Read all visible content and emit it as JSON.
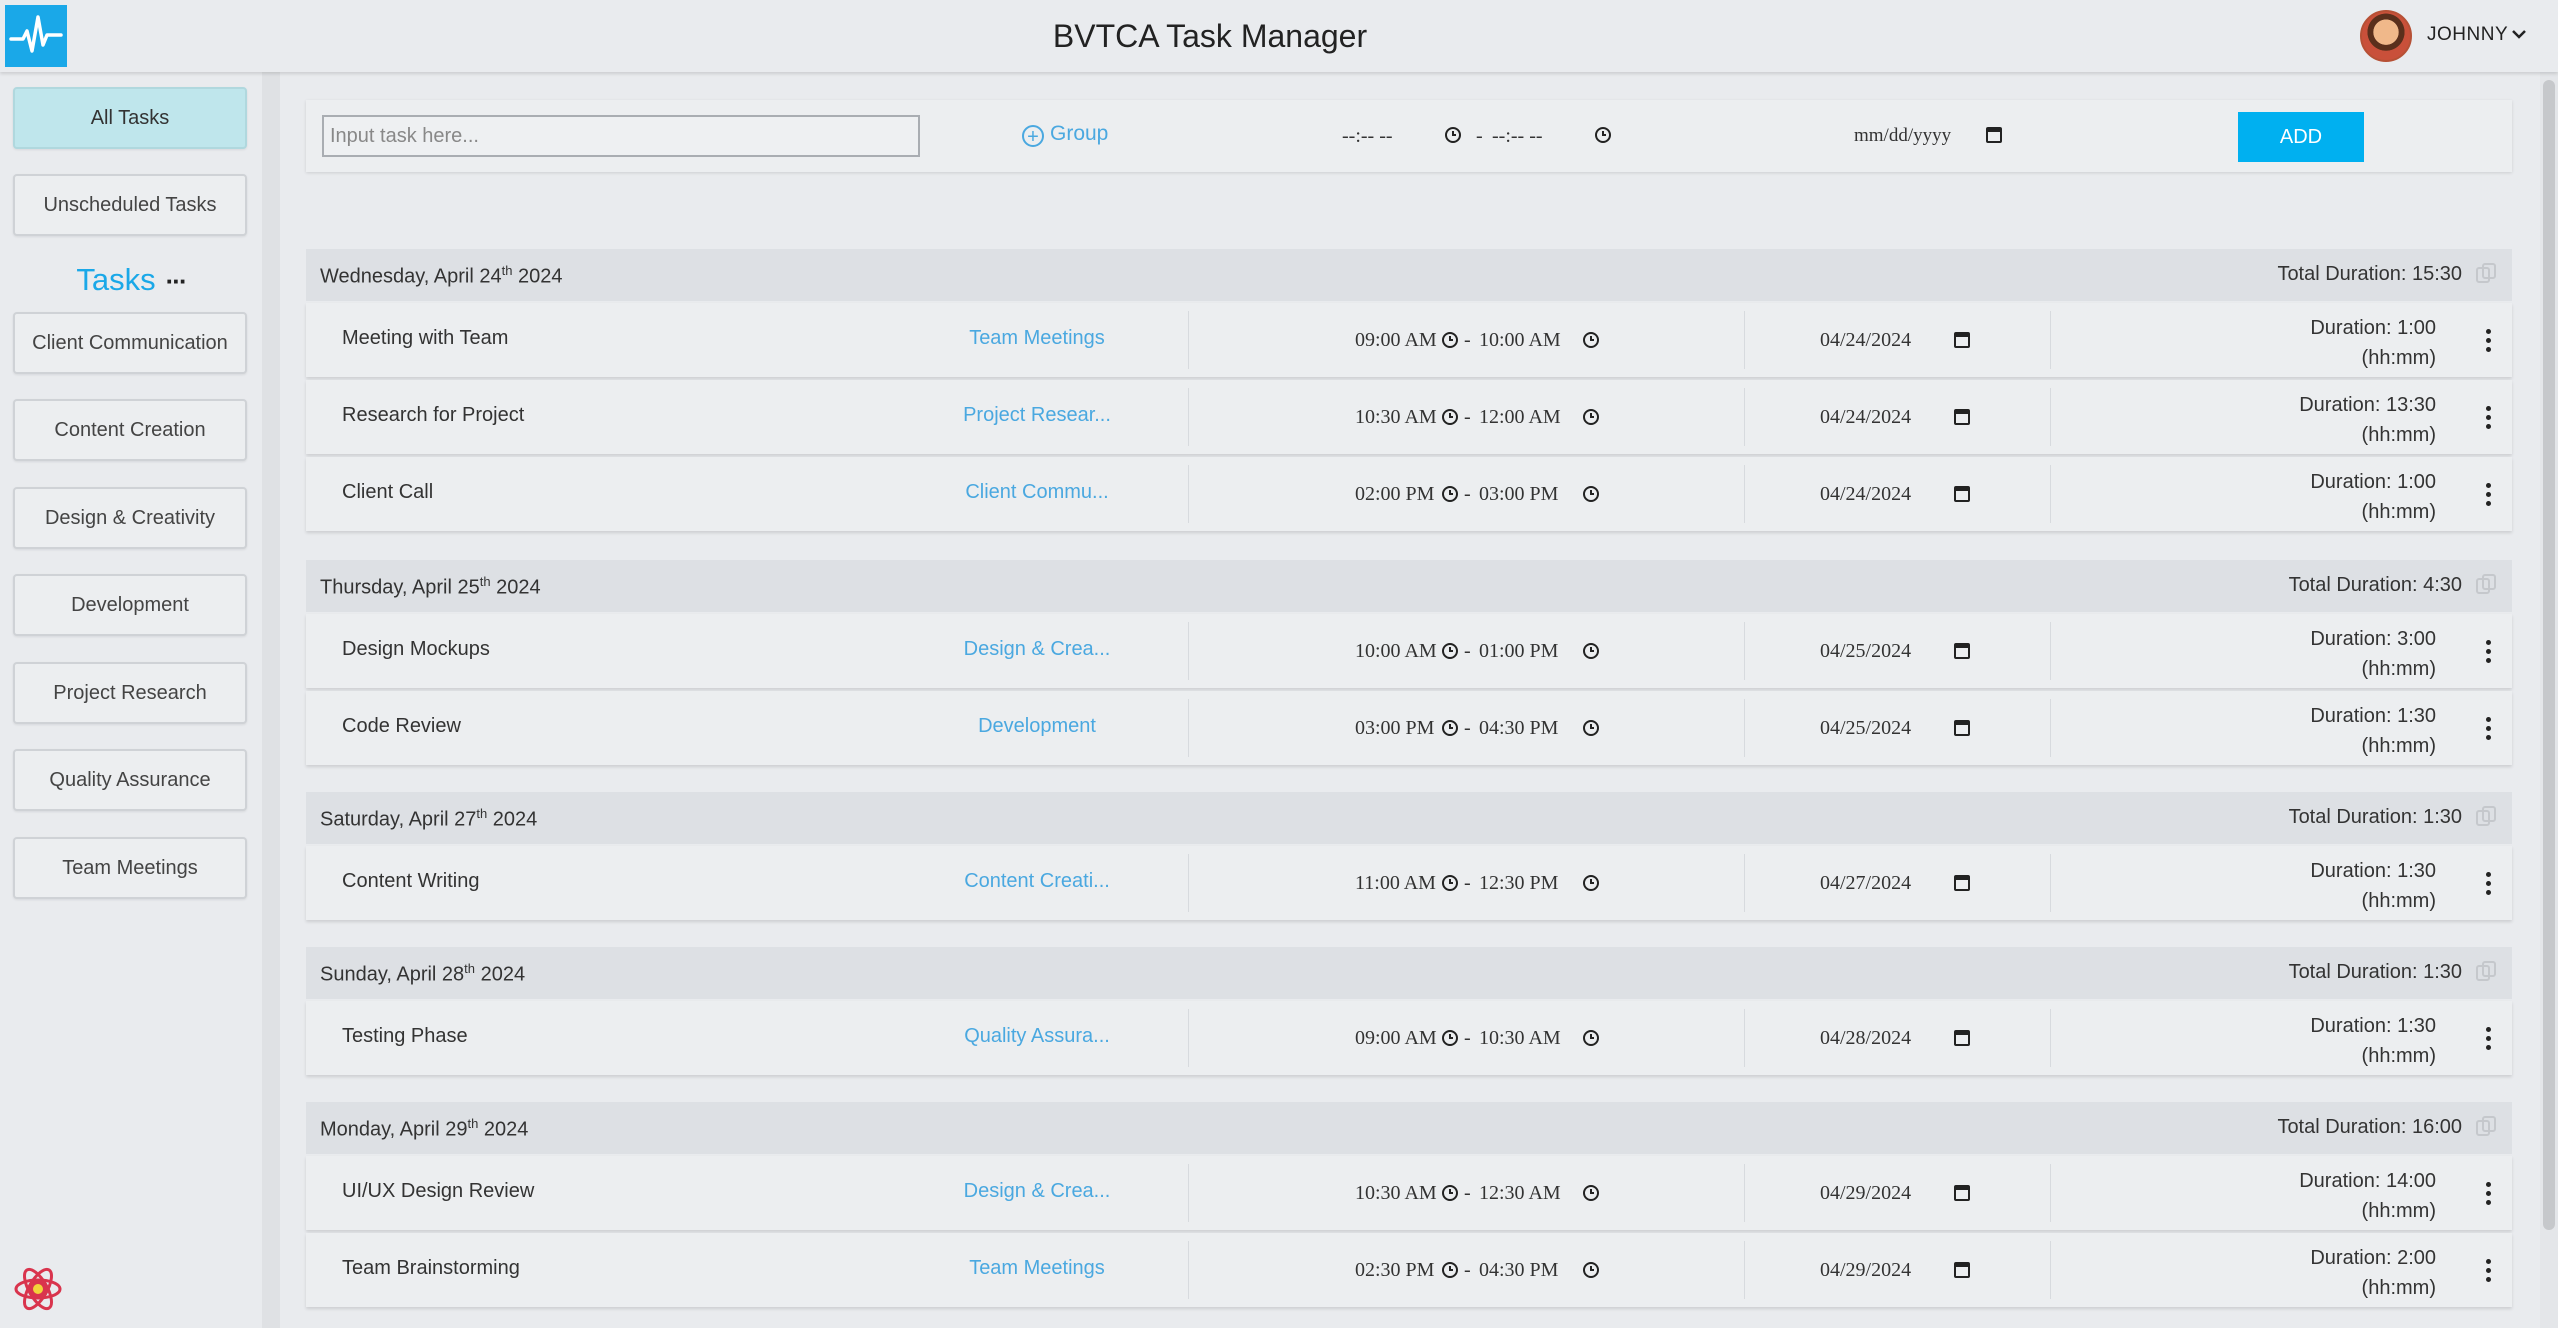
{
  "header": {
    "title": "BVTCA Task Manager",
    "username": "JOHNNY",
    "icons": {
      "logo": "heartbeat-icon",
      "menu": "chevron-down-icon"
    }
  },
  "sidebar": {
    "all_tasks": "All Tasks",
    "unscheduled": "Unscheduled Tasks",
    "tasks_heading": "Tasks",
    "tasks_more": "···",
    "groups": [
      "Client Communication",
      "Content Creation",
      "Design & Creativity",
      "Development",
      "Project Research",
      "Quality Assurance",
      "Team Meetings"
    ],
    "colors": {
      "accent": "#1aa8e8",
      "active_bg": "#bfe6ec"
    }
  },
  "input_bar": {
    "placeholder": "Input task here...",
    "group_label": "Group",
    "start_time": "--:-- --",
    "end_sep": "-",
    "end_time": "--:-- --",
    "date": "mm/dd/yyyy",
    "add_label": "ADD",
    "colors": {
      "add_button": "#00b0f0"
    }
  },
  "days": [
    {
      "date": "Wednesday, April 24",
      "suffix": "th",
      "year": " 2024",
      "total": "Total Duration: 15:30",
      "tasks": [
        {
          "name": "Meeting with Team",
          "group": "Team Meetings",
          "start": "09:00 AM",
          "end": "10:00 AM",
          "date": "04/24/2024",
          "dur": "Duration: 1:00",
          "unit": "(hh:mm)"
        },
        {
          "name": "Research for Project",
          "group": "Project Resear...",
          "start": "10:30 AM",
          "end": "12:00 AM",
          "date": "04/24/2024",
          "dur": "Duration: 13:30",
          "unit": "(hh:mm)"
        },
        {
          "name": "Client Call",
          "group": "Client Commu...",
          "start": "02:00 PM",
          "end": "03:00 PM",
          "date": "04/24/2024",
          "dur": "Duration: 1:00",
          "unit": "(hh:mm)"
        }
      ]
    },
    {
      "date": "Thursday, April 25",
      "suffix": "th",
      "year": " 2024",
      "total": "Total Duration: 4:30",
      "tasks": [
        {
          "name": "Design Mockups",
          "group": "Design & Crea...",
          "start": "10:00 AM",
          "end": "01:00 PM",
          "date": "04/25/2024",
          "dur": "Duration: 3:00",
          "unit": "(hh:mm)"
        },
        {
          "name": "Code Review",
          "group": "Development",
          "start": "03:00 PM",
          "end": "04:30 PM",
          "date": "04/25/2024",
          "dur": "Duration: 1:30",
          "unit": "(hh:mm)"
        }
      ]
    },
    {
      "date": "Saturday, April 27",
      "suffix": "th",
      "year": " 2024",
      "total": "Total Duration: 1:30",
      "tasks": [
        {
          "name": "Content Writing",
          "group": "Content Creati...",
          "start": "11:00 AM",
          "end": "12:30 PM",
          "date": "04/27/2024",
          "dur": "Duration: 1:30",
          "unit": "(hh:mm)"
        }
      ]
    },
    {
      "date": "Sunday, April 28",
      "suffix": "th",
      "year": " 2024",
      "total": "Total Duration: 1:30",
      "tasks": [
        {
          "name": "Testing Phase",
          "group": "Quality Assura...",
          "start": "09:00 AM",
          "end": "10:30 AM",
          "date": "04/28/2024",
          "dur": "Duration: 1:30",
          "unit": "(hh:mm)"
        }
      ]
    },
    {
      "date": "Monday, April 29",
      "suffix": "th",
      "year": " 2024",
      "total": "Total Duration: 16:00",
      "tasks": [
        {
          "name": "UI/UX Design Review",
          "group": "Design & Crea...",
          "start": "10:30 AM",
          "end": "12:30 AM",
          "date": "04/29/2024",
          "dur": "Duration: 14:00",
          "unit": "(hh:mm)"
        },
        {
          "name": "Team Brainstorming",
          "group": "Team Meetings",
          "start": "02:30 PM",
          "end": "04:30 PM",
          "date": "04/29/2024",
          "dur": "Duration: 2:00",
          "unit": "(hh:mm)"
        }
      ]
    }
  ]
}
